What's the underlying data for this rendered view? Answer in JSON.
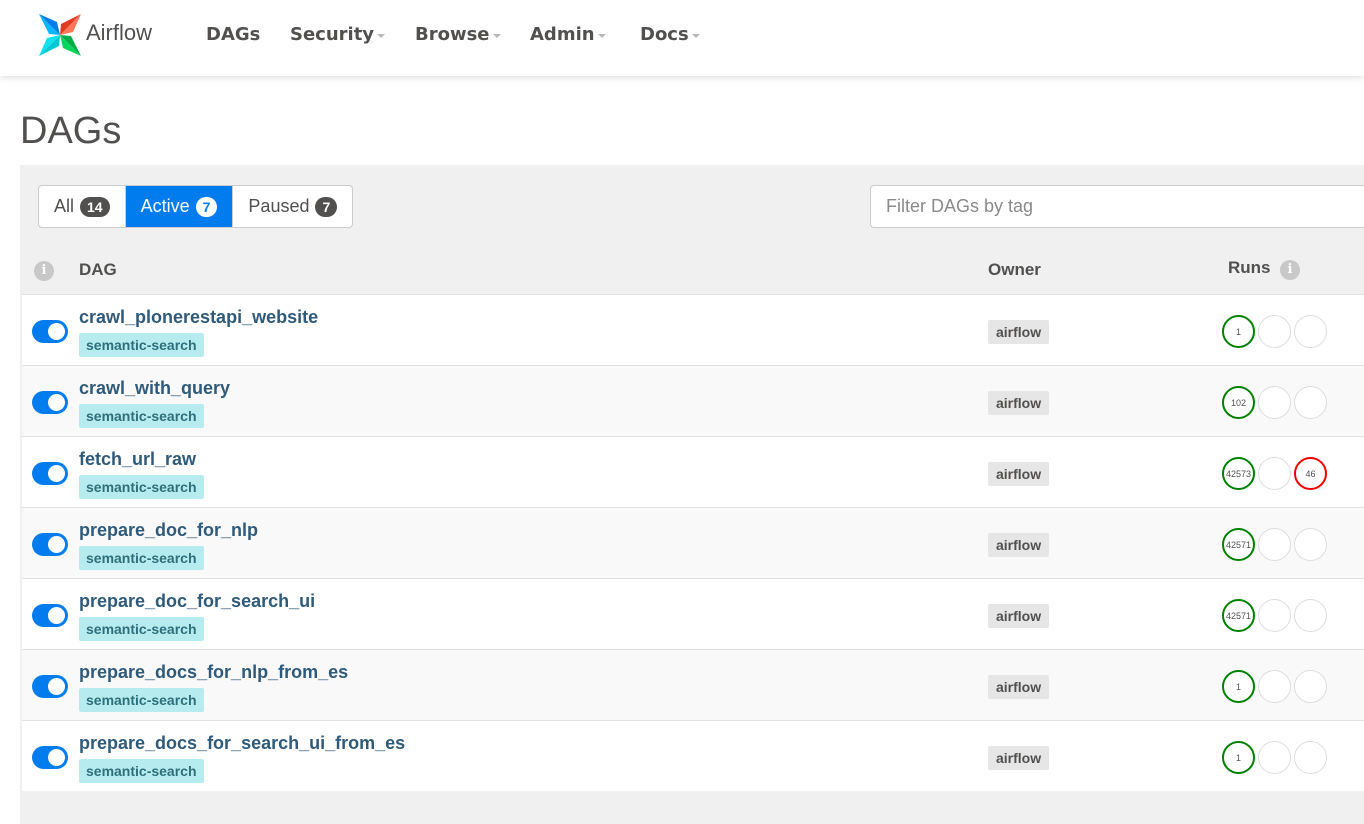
{
  "nav": {
    "brand": "Airflow",
    "items": [
      {
        "label": "DAGs",
        "caret": false
      },
      {
        "label": "Security",
        "caret": true
      },
      {
        "label": "Browse",
        "caret": true
      },
      {
        "label": "Admin",
        "caret": true
      },
      {
        "label": "Docs",
        "caret": true
      }
    ]
  },
  "page": {
    "title": "DAGs"
  },
  "filters": {
    "all": {
      "label": "All",
      "count": "14"
    },
    "active": {
      "label": "Active",
      "count": "7"
    },
    "paused": {
      "label": "Paused",
      "count": "7"
    },
    "tag_placeholder": "Filter DAGs by tag"
  },
  "table": {
    "headers": {
      "dag": "DAG",
      "owner": "Owner",
      "runs": "Runs"
    },
    "rows": [
      {
        "name": "crawl_plonerestapi_website",
        "tag": "semantic-search",
        "owner": "airflow",
        "runs": {
          "success": "1",
          "running": "",
          "failed": ""
        }
      },
      {
        "name": "crawl_with_query",
        "tag": "semantic-search",
        "owner": "airflow",
        "runs": {
          "success": "102",
          "running": "",
          "failed": ""
        }
      },
      {
        "name": "fetch_url_raw",
        "tag": "semantic-search",
        "owner": "airflow",
        "runs": {
          "success": "42573",
          "running": "",
          "failed": "46"
        }
      },
      {
        "name": "prepare_doc_for_nlp",
        "tag": "semantic-search",
        "owner": "airflow",
        "runs": {
          "success": "42571",
          "running": "",
          "failed": ""
        }
      },
      {
        "name": "prepare_doc_for_search_ui",
        "tag": "semantic-search",
        "owner": "airflow",
        "runs": {
          "success": "42571",
          "running": "",
          "failed": ""
        }
      },
      {
        "name": "prepare_docs_for_nlp_from_es",
        "tag": "semantic-search",
        "owner": "airflow",
        "runs": {
          "success": "1",
          "running": "",
          "failed": ""
        }
      },
      {
        "name": "prepare_docs_for_search_ui_from_es",
        "tag": "semantic-search",
        "owner": "airflow",
        "runs": {
          "success": "1",
          "running": "",
          "failed": ""
        }
      }
    ]
  },
  "colors": {
    "accent": "#017cee",
    "success": "#008000",
    "failed": "#ee0000",
    "tag_bg": "#b6ecf0"
  }
}
